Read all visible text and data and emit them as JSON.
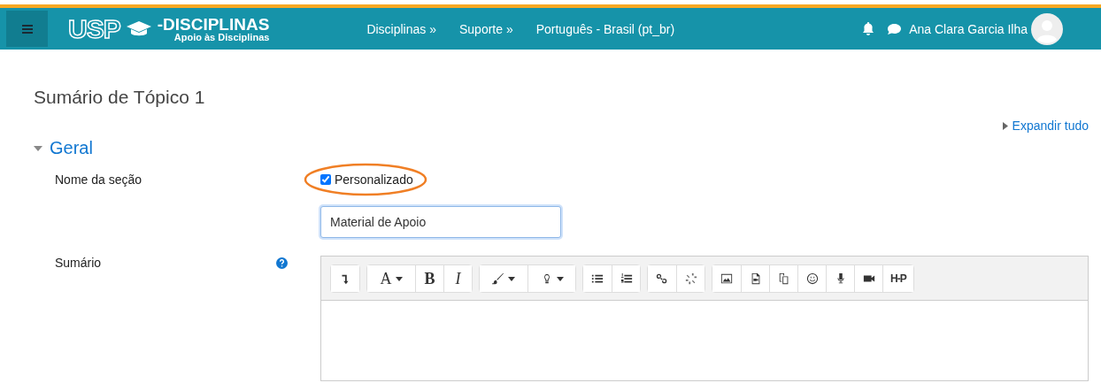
{
  "navbar": {
    "logo": {
      "mark": "USP",
      "title": "-DISCIPLINAS",
      "subtitle": "Apoio às Disciplinas"
    },
    "links": [
      "Disciplinas »",
      "Suporte »",
      "Português - Brasil (pt_br)"
    ],
    "user": "Ana Clara Garcia Ilha"
  },
  "page": {
    "title": "Sumário de Tópico 1",
    "expand_all": "Expandir tudo",
    "section": {
      "title": "Geral",
      "expanded": true
    },
    "fields": [
      {
        "kind": "checkbox",
        "label": "Nome da seção",
        "option": "Personalizado",
        "checked": true,
        "highlighted": true
      },
      {
        "kind": "text",
        "value": "Material de Apoio"
      },
      {
        "kind": "editor",
        "label": "Sumário",
        "help": true,
        "toolbar": [
          {
            "buttons": [
              {
                "kind": "icon"
              }
            ]
          },
          {
            "buttons": [
              {
                "kind": "textmenu",
                "label": "A"
              },
              {
                "kind": "bold",
                "label": "B"
              },
              {
                "kind": "italic",
                "label": "I"
              }
            ]
          },
          {
            "buttons": [
              {
                "kind": "iconmenu"
              },
              {
                "kind": "iconmenu"
              }
            ]
          },
          {
            "buttons": [
              {
                "kind": "icon"
              },
              {
                "kind": "icon"
              }
            ]
          },
          {
            "buttons": [
              {
                "kind": "icon"
              },
              {
                "kind": "icon"
              }
            ]
          },
          {
            "buttons": [
              {
                "kind": "icon"
              },
              {
                "kind": "icon"
              },
              {
                "kind": "icon"
              },
              {
                "kind": "icon"
              },
              {
                "kind": "icon"
              },
              {
                "kind": "icon"
              },
              {
                "kind": "logo",
                "label": "H-P"
              }
            ]
          }
        ]
      }
    ]
  }
}
